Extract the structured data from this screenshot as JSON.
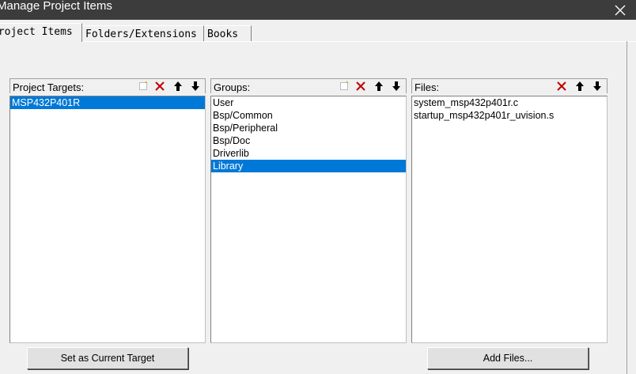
{
  "window": {
    "title": "Manage Project Items",
    "close_icon": "close-icon"
  },
  "tabs": [
    {
      "label": "Project Items",
      "active": true
    },
    {
      "label": "Folders/Extensions",
      "active": false
    },
    {
      "label": "Books",
      "active": false
    }
  ],
  "panels": {
    "targets": {
      "label": "Project Targets:",
      "toolbar_icons": [
        "new-icon",
        "delete-icon",
        "move-up-icon",
        "move-down-icon"
      ],
      "items": [
        {
          "text": "MSP432P401R",
          "selected": true
        }
      ]
    },
    "groups": {
      "label": "Groups:",
      "toolbar_icons": [
        "new-icon",
        "delete-icon",
        "move-up-icon",
        "move-down-icon"
      ],
      "items": [
        {
          "text": "User",
          "selected": false
        },
        {
          "text": "Bsp/Common",
          "selected": false
        },
        {
          "text": "Bsp/Peripheral",
          "selected": false
        },
        {
          "text": "Bsp/Doc",
          "selected": false
        },
        {
          "text": "Driverlib",
          "selected": false
        },
        {
          "text": "Library",
          "selected": true
        }
      ]
    },
    "files": {
      "label": "Files:",
      "toolbar_icons": [
        "delete-icon",
        "move-up-icon",
        "move-down-icon"
      ],
      "items": [
        {
          "text": "system_msp432p401r.c",
          "selected": false
        },
        {
          "text": "startup_msp432p401r_uvision.s",
          "selected": false
        }
      ]
    }
  },
  "buttons": {
    "set_target": "Set as Current Target",
    "add_files": "Add Files..."
  },
  "colors": {
    "titlebar": "#3c3c3c",
    "selection": "#0078d7",
    "delete_red": "#c00000"
  }
}
